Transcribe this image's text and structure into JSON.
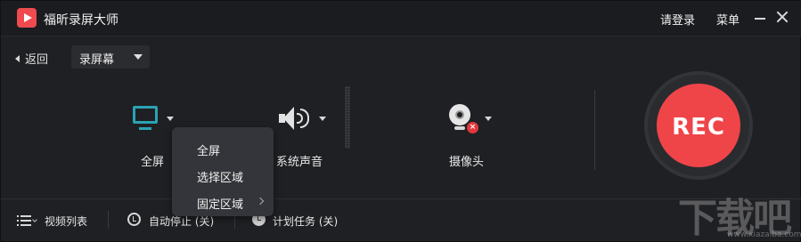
{
  "titlebar": {
    "app_name": "福昕录屏大师",
    "login": "请登录",
    "menu": "菜单"
  },
  "subbar": {
    "back": "返回",
    "mode": "录屏幕"
  },
  "controls": {
    "screen_label": "全屏",
    "audio_label": "系统声音",
    "camera_label": "摄像头",
    "rec_label": "REC"
  },
  "screen_dropdown": {
    "items": [
      "全屏",
      "选择区域",
      "固定区域"
    ]
  },
  "bottombar": {
    "video_list": "视频列表",
    "auto_stop": "自动停止 (关)",
    "schedule": "计划任务 (关)"
  },
  "watermark": {
    "text": "下载吧",
    "url": "www.xiazaiba.com"
  },
  "colors": {
    "accent_rec": "#ef4549",
    "monitor_teal": "#2aa3b4",
    "background": "#1f2023"
  }
}
